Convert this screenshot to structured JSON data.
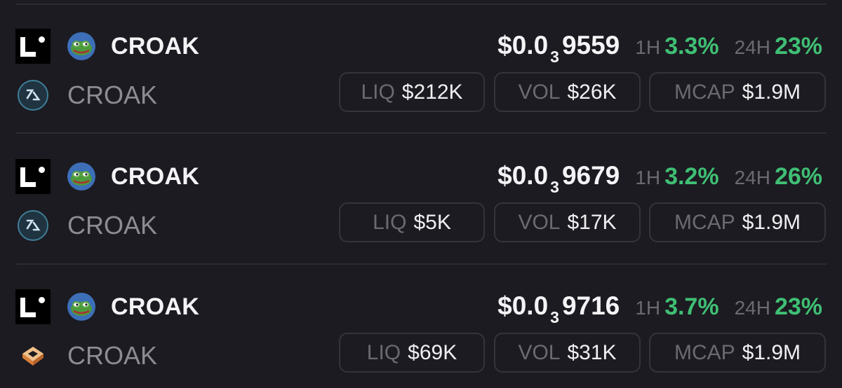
{
  "rows": [
    {
      "token": "CROAK",
      "pair": "CROAK",
      "dex_icon": "swirl-dex-icon",
      "price": {
        "prefix": "$0.0",
        "zeros": "3",
        "digits": "9559"
      },
      "h1_label": "1H",
      "h1_change": "3.3%",
      "h24_label": "24H",
      "h24_change": "23%",
      "liq_label": "LIQ",
      "liq": "$212K",
      "vol_label": "VOL",
      "vol": "$26K",
      "mcap_label": "MCAP",
      "mcap": "$1.9M"
    },
    {
      "token": "CROAK",
      "pair": "CROAK",
      "dex_icon": "swirl-dex-icon",
      "price": {
        "prefix": "$0.0",
        "zeros": "3",
        "digits": "9679"
      },
      "h1_label": "1H",
      "h1_change": "3.2%",
      "h24_label": "24H",
      "h24_change": "26%",
      "liq_label": "LIQ",
      "liq": "$5K",
      "vol_label": "VOL",
      "vol": "$17K",
      "mcap_label": "MCAP",
      "mcap": "$1.9M"
    },
    {
      "token": "CROAK",
      "pair": "CROAK",
      "dex_icon": "orange-cube-dex-icon",
      "price": {
        "prefix": "$0.0",
        "zeros": "3",
        "digits": "9716"
      },
      "h1_label": "1H",
      "h1_change": "3.7%",
      "h24_label": "24H",
      "h24_change": "23%",
      "liq_label": "LIQ",
      "liq": "$69K",
      "vol_label": "VOL",
      "vol": "$31K",
      "mcap_label": "MCAP",
      "mcap": "$1.9M"
    }
  ],
  "colors": {
    "background": "#1c1b21",
    "positive": "#3fbf74",
    "muted": "#6b6a71",
    "border": "#35343b"
  },
  "icons": {
    "chain": "linea-chain-icon",
    "token_avatar": "pepe-frog-icon"
  }
}
